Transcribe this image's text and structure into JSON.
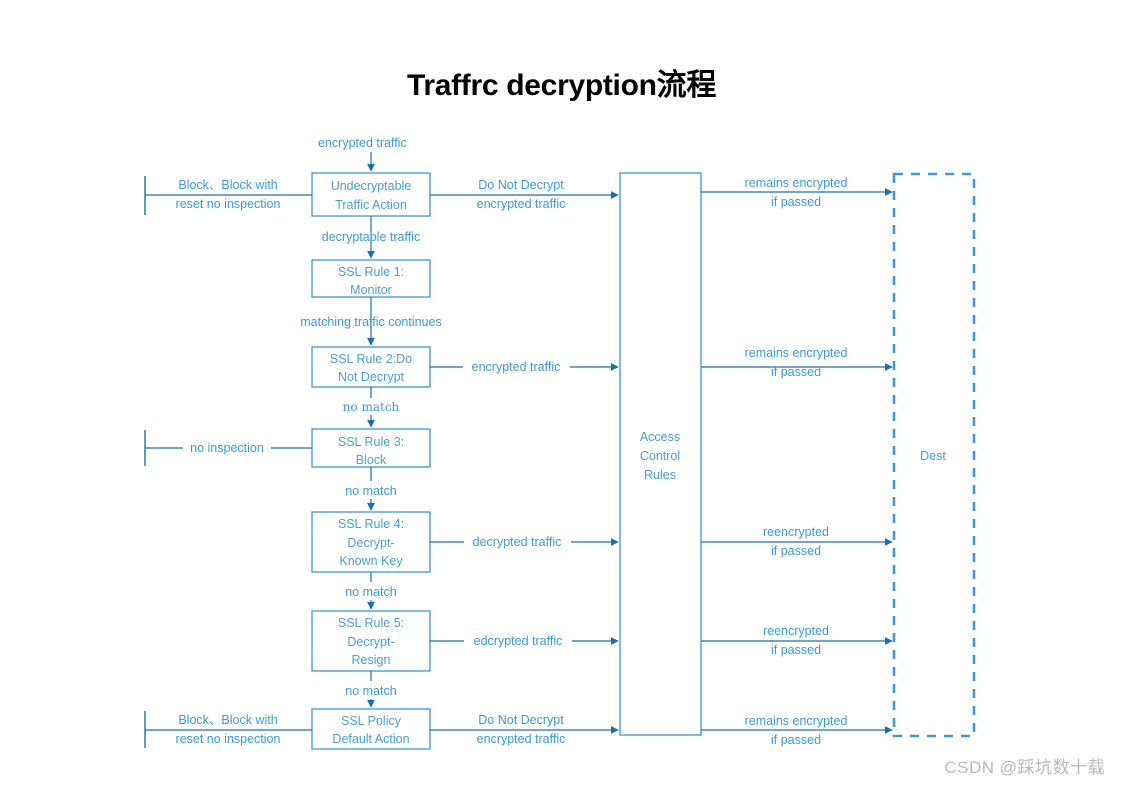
{
  "title": "Traffrc decryption流程",
  "colors": {
    "accent": "#3d9ad6",
    "line": "#1f6fa8",
    "box_stroke": "#2e8ccf",
    "title": "#000000",
    "watermark": "#b9b9b9"
  },
  "watermark": "CSDN @踩坑数十载",
  "nodes": {
    "undecryptable": {
      "line1": "Undecryptable",
      "line2": "Traffic Action"
    },
    "rule1": {
      "line1": "SSL Rule 1:",
      "line2": "Monitor"
    },
    "rule2": {
      "line1": "SSL Rule 2:Do",
      "line2": "Not Decrypt"
    },
    "rule3": {
      "line1": "SSL Rule 3:",
      "line2": "Block"
    },
    "rule4": {
      "line1": "SSL Rule 4:",
      "line2": "Decrypt-",
      "line3": "Known Key"
    },
    "rule5": {
      "line1": "SSL Rule 5:",
      "line2": "Decrypt-",
      "line3": "Resign"
    },
    "default_action": {
      "line1": "SSL Policy",
      "line2": "Default Action"
    },
    "access_control": {
      "line1": "Access",
      "line2": "Control",
      "line3": "Rules"
    },
    "dest": {
      "label": "Dest"
    }
  },
  "edges": {
    "top_input": "encrypted traffic",
    "undecryptable_left_1": "Block、Block with",
    "undecryptable_left_2": "reset no inspection",
    "undecryptable_right_1": "Do Not Decrypt",
    "undecryptable_right_2": "encrypted traffic",
    "to_rule1": "decryptable traffic",
    "to_rule2": "matching traffic continues",
    "rule2_right": "encrypted traffic",
    "rule2_to_rule3": "no match",
    "rule3_left": "no inspection",
    "rule3_to_rule4": "no match",
    "rule4_right": "decrypted traffic",
    "rule4_to_rule5": "no match",
    "rule5_right": "edcrypted traffic",
    "rule5_to_default": "no match",
    "default_left_1": "Block、Block with",
    "default_left_2": "reset no inspection",
    "default_right_1": "Do Not Decrypt",
    "default_right_2": "encrypted traffic",
    "acr_out_1a": "remains encrypted",
    "acr_out_1b": "if passed",
    "acr_out_2a": "remains encrypted",
    "acr_out_2b": "if passed",
    "acr_out_3a": "reencrypted",
    "acr_out_3b": "if passed",
    "acr_out_4a": "reencrypted",
    "acr_out_4b": "if passed",
    "acr_out_5a": "remains encrypted",
    "acr_out_5b": "if passed"
  }
}
